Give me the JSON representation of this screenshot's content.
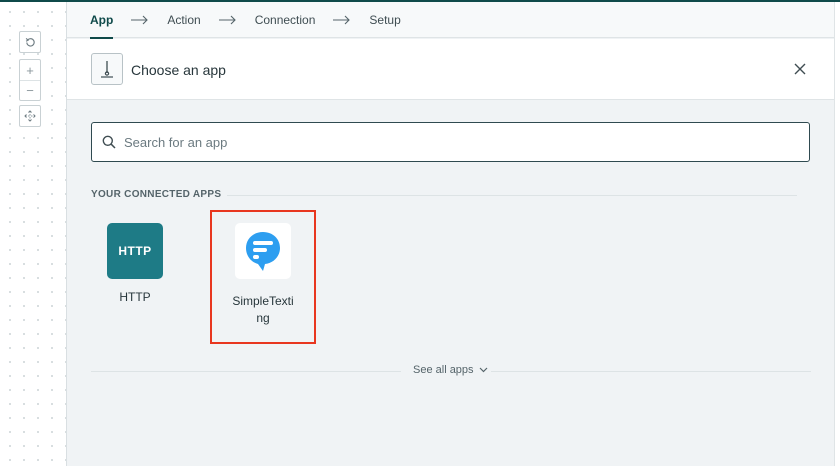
{
  "steps": [
    {
      "label": "App",
      "active": true
    },
    {
      "label": "Action",
      "active": false
    },
    {
      "label": "Connection",
      "active": false
    },
    {
      "label": "Setup",
      "active": false
    }
  ],
  "header": {
    "title": "Choose an app",
    "icon": "connector-icon",
    "close_icon": "close-icon"
  },
  "search": {
    "placeholder": "Search for an app",
    "value": "",
    "icon": "search-icon"
  },
  "connected_apps": {
    "heading": "YOUR CONNECTED APPS",
    "apps": [
      {
        "name": "HTTP",
        "logo_text": "HTTP",
        "logo_color": "#1e7b86"
      },
      {
        "name": "SimpleTexti ng",
        "logo": "simpletexting-logo",
        "logo_color": "#2d9ef0",
        "highlighted": true
      }
    ]
  },
  "see_all": {
    "label": "See all apps",
    "icon": "chevron-down-icon"
  },
  "canvas_controls": {
    "reset_icon": "reset-icon",
    "zoom_in": "+",
    "zoom_out": "−",
    "fit_icon": "fit-icon"
  },
  "colors": {
    "accent": "#0f4a4a",
    "highlight": "#e8361f"
  }
}
